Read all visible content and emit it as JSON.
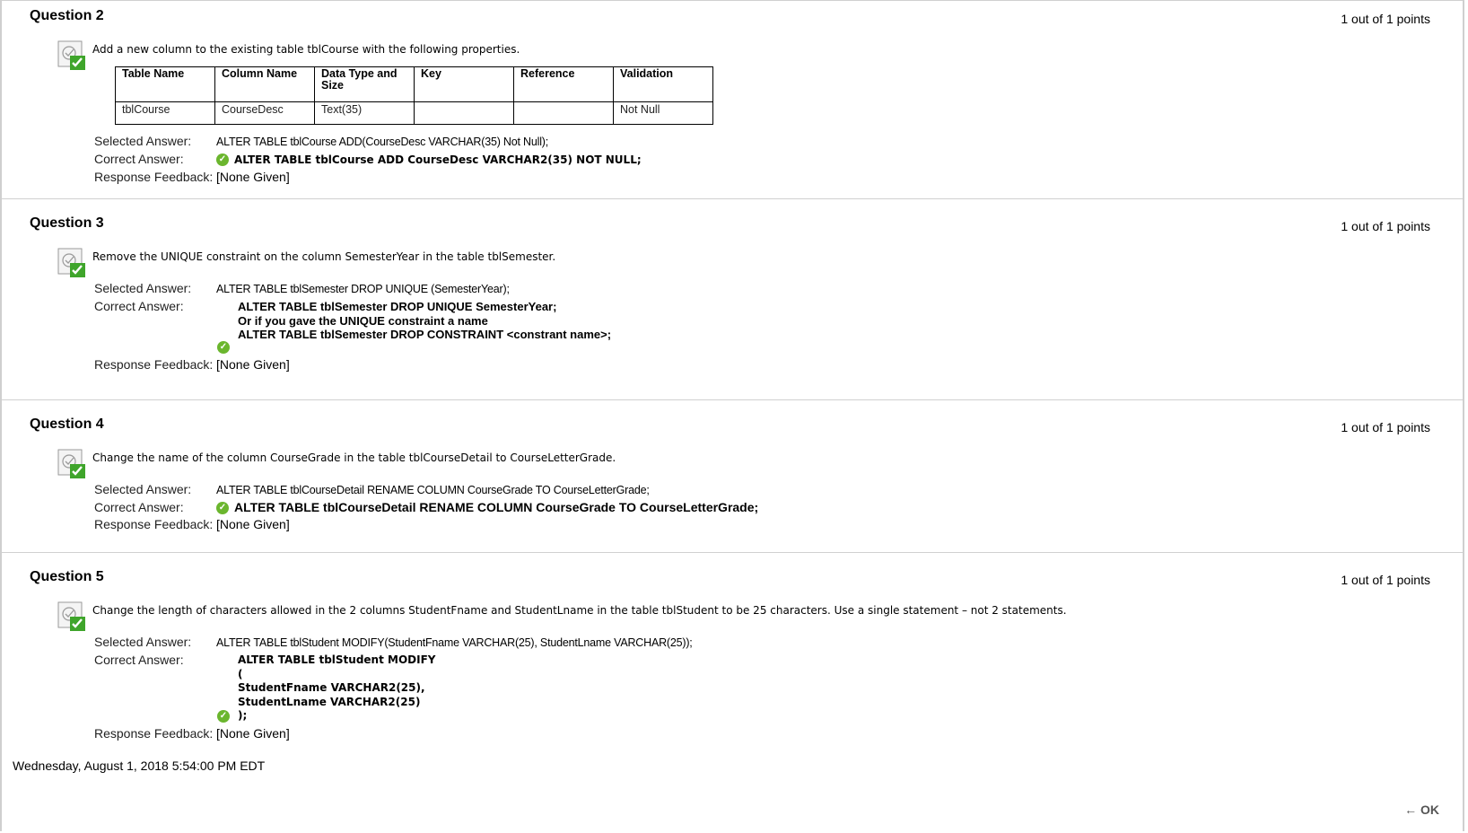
{
  "questions": [
    {
      "title": "Question 2",
      "points": "1 out of 1 points",
      "prompt": "Add a new column to the existing table tblCourse with the following properties.",
      "table": {
        "headers": [
          "Table Name",
          "Column Name",
          "Data Type and Size",
          "Key",
          "Reference",
          "Validation"
        ],
        "row": [
          "tblCourse",
          "CourseDesc",
          "Text(35)",
          "",
          "",
          "Not Null"
        ]
      },
      "selected_label": "Selected Answer:",
      "selected_answer": "ALTER TABLE tblCourse ADD(CourseDesc VARCHAR(35) Not Null);",
      "correct_label": "Correct Answer:",
      "correct_answer": "ALTER TABLE tblCourse ADD CourseDesc VARCHAR2(35) NOT NULL;",
      "feedback_label": "Response Feedback:",
      "feedback": "[None Given]"
    },
    {
      "title": "Question 3",
      "points": "1 out of 1 points",
      "prompt": "Remove the UNIQUE constraint on the column SemesterYear in the table tblSemester.",
      "selected_label": "Selected Answer:",
      "selected_answer": "ALTER TABLE tblSemester DROP UNIQUE (SemesterYear);",
      "correct_label": "Correct Answer:",
      "correct_lines": [
        "ALTER TABLE tblSemester DROP UNIQUE SemesterYear;",
        "Or if you gave the UNIQUE constraint a name",
        "ALTER TABLE tblSemester DROP CONSTRAINT <constrant name>;"
      ],
      "feedback_label": "Response Feedback:",
      "feedback": "[None Given]"
    },
    {
      "title": "Question 4",
      "points": "1 out of 1 points",
      "prompt": "Change the name of the column CourseGrade in the table tblCourseDetail to CourseLetterGrade.",
      "selected_label": "Selected Answer:",
      "selected_answer": "ALTER TABLE tblCourseDetail RENAME COLUMN CourseGrade TO CourseLetterGrade;",
      "correct_label": "Correct Answer:",
      "correct_answer": "ALTER TABLE tblCourseDetail RENAME COLUMN CourseGrade TO CourseLetterGrade;",
      "feedback_label": "Response Feedback:",
      "feedback": "[None Given]"
    },
    {
      "title": "Question 5",
      "points": "1 out of 1 points",
      "prompt": "Change the length of characters allowed in the 2 columns StudentFname and StudentLname in the table tblStudent to be 25 characters.  Use a single statement – not 2 statements.",
      "selected_label": "Selected Answer:",
      "selected_answer": "ALTER TABLE tblStudent MODIFY(StudentFname VARCHAR(25), StudentLname VARCHAR(25));",
      "correct_label": "Correct Answer:",
      "correct_lines": [
        "ALTER TABLE tblStudent MODIFY",
        "(",
        "StudentFname VARCHAR2(25),",
        "StudentLname VARCHAR2(25)",
        ");"
      ],
      "feedback_label": "Response Feedback:",
      "feedback": "[None Given]"
    }
  ],
  "timestamp": "Wednesday, August 1, 2018 5:54:00 PM EDT",
  "ok_button": "← OK",
  "icons": {
    "graded": "graded-check-icon",
    "correct": "correct-check-icon"
  },
  "colors": {
    "check_green": "#6bb62e",
    "divider": "#d0d0d0"
  }
}
